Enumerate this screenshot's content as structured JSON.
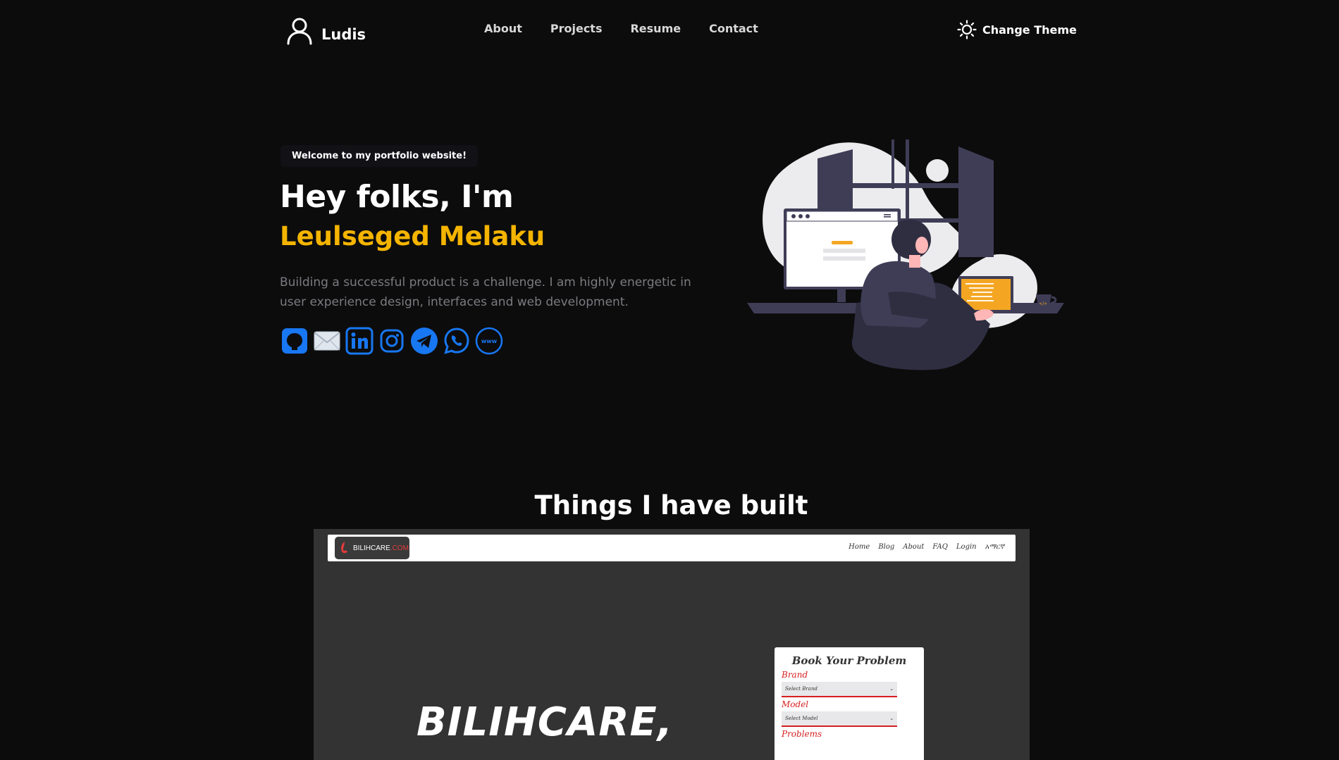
{
  "brand": {
    "name": "Ludis",
    "icon": "user-icon"
  },
  "nav": {
    "links": [
      "About",
      "Projects",
      "Resume",
      "Contact"
    ],
    "theme_label": "Change Theme",
    "theme_icon": "sun-icon"
  },
  "hero": {
    "badge": "Welcome to my portfolio website!",
    "greeting": "Hey folks, I'm",
    "name": "Leulseged Melaku",
    "description": "Building a successful product is a challenge. I am highly energetic in user experience design, interfaces and web development.",
    "socials": [
      "github-icon",
      "email-icon",
      "linkedin-icon",
      "instagram-icon",
      "telegram-icon",
      "whatsapp-icon",
      "website-icon"
    ],
    "accent": "#f4b400",
    "social_color": "#1877f2"
  },
  "projects": {
    "title": "Things I have built",
    "preview": {
      "logo_text": "BILIHCARE",
      "logo_suffix": ".COM",
      "menu": [
        "Home",
        "Blog",
        "About",
        "FAQ",
        "Login",
        "አማርኛ"
      ],
      "headline": "BILIHCARE,",
      "form": {
        "title": "Book Your Problem",
        "brand_label": "Brand",
        "brand_placeholder": "Select Brand",
        "model_label": "Model",
        "model_placeholder": "Select Model",
        "problems_label": "Problems"
      }
    }
  }
}
